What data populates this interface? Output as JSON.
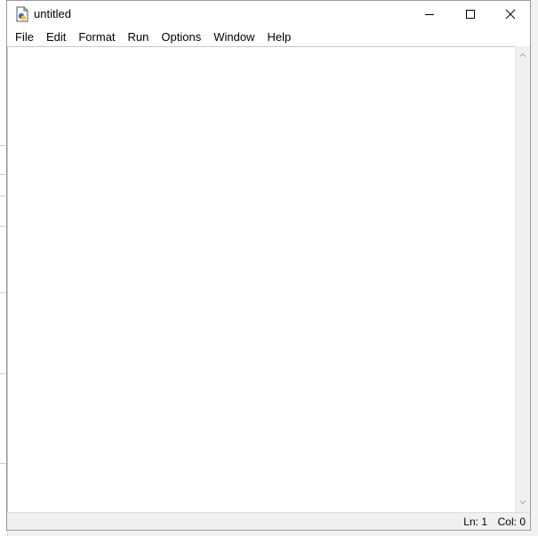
{
  "window": {
    "title": "untitled",
    "icon": "python-idle-file-icon"
  },
  "menubar": {
    "items": [
      {
        "label": "File"
      },
      {
        "label": "Edit"
      },
      {
        "label": "Format"
      },
      {
        "label": "Run"
      },
      {
        "label": "Options"
      },
      {
        "label": "Window"
      },
      {
        "label": "Help"
      }
    ]
  },
  "editor": {
    "content": ""
  },
  "statusbar": {
    "line": "Ln: 1",
    "column": "Col: 0"
  },
  "colors": {
    "window_bg": "#ffffff",
    "statusbar_bg": "#f0f0f0",
    "border": "#9a9a9a"
  }
}
